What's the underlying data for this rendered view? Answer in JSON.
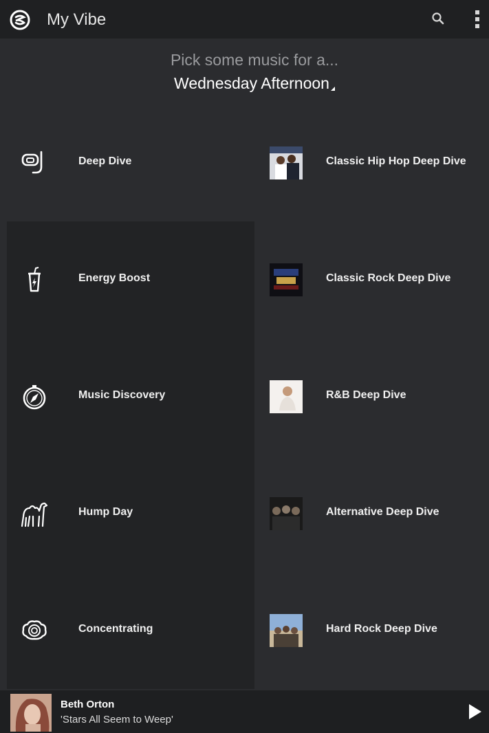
{
  "topbar": {
    "title": "My Vibe",
    "logo_icon": "songza-logo-icon",
    "search_icon": "search-icon",
    "menu_icon": "overflow-menu-icon"
  },
  "header": {
    "prompt": "Pick some music for a...",
    "time_selector": "Wednesday Afternoon"
  },
  "left_items": [
    {
      "label": "Deep Dive",
      "icon": "snorkel-mask-icon"
    },
    {
      "label": "Energy Boost",
      "icon": "energy-drink-icon"
    },
    {
      "label": "Music Discovery",
      "icon": "compass-icon"
    },
    {
      "label": "Hump Day",
      "icon": "camel-icon"
    },
    {
      "label": "Concentrating",
      "icon": "brain-icon"
    }
  ],
  "right_items": [
    {
      "label": "Classic Hip Hop Deep Dive",
      "icon": "album-art-thumbnail"
    },
    {
      "label": "Classic Rock Deep Dive",
      "icon": "album-art-thumbnail"
    },
    {
      "label": "R&B Deep Dive",
      "icon": "album-art-thumbnail"
    },
    {
      "label": "Alternative Deep Dive",
      "icon": "album-art-thumbnail"
    },
    {
      "label": "Hard Rock Deep Dive",
      "icon": "album-art-thumbnail"
    }
  ],
  "now_playing": {
    "artist": "Beth Orton",
    "track": "'Stars All Seem to Weep'",
    "play_icon": "play-icon"
  },
  "colors": {
    "background": "#2b2c2f",
    "topbar": "#1f2022",
    "left_column": "#222325",
    "now_playing_bar": "#1e1f21",
    "prompt_text": "#9a9b9e"
  }
}
